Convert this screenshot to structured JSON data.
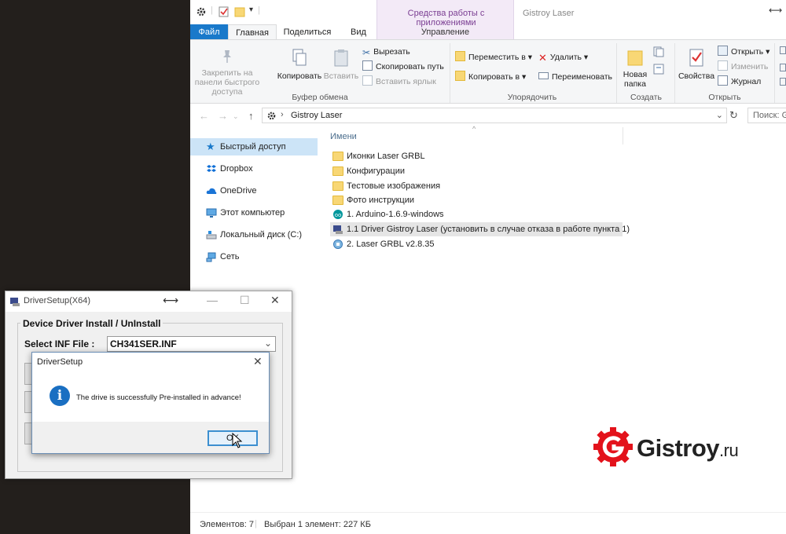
{
  "explorer": {
    "title": "Gistroy Laser",
    "contextual_tab_group": "Средства работы с приложениями",
    "tabs": {
      "file": "Файл",
      "home": "Главная",
      "share": "Поделиться",
      "view": "Вид",
      "manage": "Управление"
    },
    "ribbon": {
      "clipboard": {
        "pin": "Закрепить на панели быстрого доступа",
        "copy": "Копировать",
        "paste": "Вставить",
        "cut": "Вырезать",
        "copy_path": "Скопировать путь",
        "paste_shortcut": "Вставить ярлык",
        "label": "Буфер обмена"
      },
      "organize": {
        "move_to": "Переместить в",
        "copy_to": "Копировать в",
        "delete": "Удалить",
        "rename": "Переименовать",
        "label": "Упорядочить"
      },
      "new": {
        "new_folder": "Новая папка",
        "label": "Создать"
      },
      "open": {
        "properties": "Свойства",
        "open": "Открыть",
        "edit": "Изменить",
        "history": "Журнал",
        "label": "Открыть"
      }
    },
    "address": {
      "path": "Gistroy Laser",
      "search_placeholder": "Поиск: G"
    },
    "nav": [
      {
        "label": "Быстрый доступ"
      },
      {
        "label": "Dropbox"
      },
      {
        "label": "OneDrive"
      },
      {
        "label": "Этот компьютер"
      },
      {
        "label": "Локальный диск (C:)"
      },
      {
        "label": "Сеть"
      }
    ],
    "column_header": "Имени",
    "files": [
      {
        "name": "Иконки Laser GRBL",
        "type": "folder"
      },
      {
        "name": "Конфигурации",
        "type": "folder"
      },
      {
        "name": "Тестовые изображения",
        "type": "folder"
      },
      {
        "name": "Фото инструкции",
        "type": "folder"
      },
      {
        "name": "1. Arduino-1.6.9-windows",
        "type": "arduino"
      },
      {
        "name": "1.1 Driver Gistroy Laser (установить в случае отказа в работе пункта 1)",
        "type": "exe"
      },
      {
        "name": "2. Laser GRBL v2.8.35",
        "type": "installer"
      }
    ],
    "status": {
      "count": "Элементов: 7",
      "selection": "Выбран 1 элемент: 227 КБ"
    }
  },
  "driversetup": {
    "title": "DriverSetup(X64)",
    "group_title": "Device Driver Install / UnInstall",
    "inf_label": "Select INF File :",
    "inf_value": "CH341SER.INF"
  },
  "msgbox": {
    "title": "DriverSetup",
    "message": "The drive is successfully Pre-installed in advance!",
    "ok": "OK"
  },
  "logo": {
    "brand": "Gistroy",
    "tld": ".ru",
    "colors": {
      "brand_red": "#e3121b"
    }
  },
  "colors": {
    "file_tab": "#1979ca",
    "selection": "#cce4f7",
    "contextual": "#7a3d92"
  }
}
